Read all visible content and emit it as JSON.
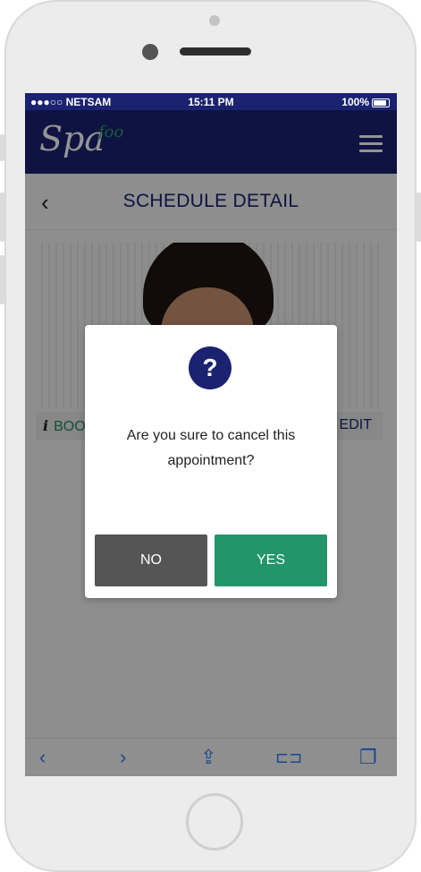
{
  "status_bar": {
    "carrier": "●●●○○ NETSAM",
    "time": "15:11 PM",
    "battery": "100%"
  },
  "header": {
    "logo_text": "Spa",
    "logo_sub": "foo"
  },
  "subheader": {
    "back_symbol": "‹",
    "title": "SCHEDULE DETAIL"
  },
  "actions": {
    "info_icon": "i",
    "book_label": "BOO",
    "edit_label": "EDIT"
  },
  "dialog": {
    "icon": "?",
    "message": "Are you sure to cancel this appointment?",
    "no_label": "NO",
    "yes_label": "YES"
  },
  "toolbar": {
    "back": "‹",
    "forward": "›",
    "share": "⇪",
    "bookmarks": "⊏⊐",
    "tabs": "❐"
  },
  "colors": {
    "navy": "#1b2270",
    "green": "#24956a",
    "gray_button": "#555555"
  }
}
